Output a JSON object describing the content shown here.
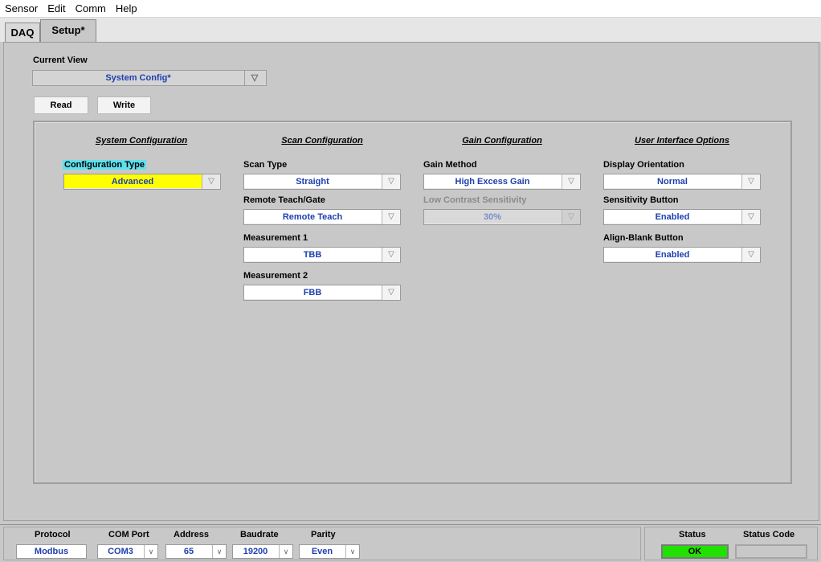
{
  "menu": [
    "Sensor",
    "Edit",
    "Comm",
    "Help"
  ],
  "tabs": {
    "daq": "DAQ",
    "setup": "Setup*"
  },
  "current_view": {
    "label": "Current View",
    "value": "System Config*"
  },
  "buttons": {
    "read": "Read",
    "write": "Write"
  },
  "sections": {
    "system": {
      "title": "System Configuration",
      "config_type_label": "Configuration Type",
      "config_type_value": "Advanced"
    },
    "scan": {
      "title": "Scan Configuration",
      "scan_type_label": "Scan Type",
      "scan_type_value": "Straight",
      "remote_label": "Remote Teach/Gate",
      "remote_value": "Remote Teach",
      "m1_label": "Measurement 1",
      "m1_value": "TBB",
      "m2_label": "Measurement 2",
      "m2_value": "FBB"
    },
    "gain": {
      "title": "Gain Configuration",
      "method_label": "Gain Method",
      "method_value": "High Excess Gain",
      "lcs_label": "Low Contrast Sensitivity",
      "lcs_value": "30%"
    },
    "ui": {
      "title": "User Interface Options",
      "orientation_label": "Display Orientation",
      "orientation_value": "Normal",
      "sens_label": "Sensitivity Button",
      "sens_value": "Enabled",
      "align_label": "Align-Blank Button",
      "align_value": "Enabled"
    }
  },
  "comm": {
    "protocol_label": "Protocol",
    "protocol_value": "Modbus",
    "port_label": "COM Port",
    "port_value": "COM3",
    "address_label": "Address",
    "address_value": "65",
    "baud_label": "Baudrate",
    "baud_value": "19200",
    "parity_label": "Parity",
    "parity_value": "Even"
  },
  "status": {
    "label": "Status",
    "value": "OK",
    "code_label": "Status Code",
    "code_value": ""
  },
  "colors": {
    "accent_blue": "#1f3fb0",
    "highlight_yellow": "#ffff00",
    "label_cyan": "#5fe1ee",
    "status_green": "#22e000"
  }
}
